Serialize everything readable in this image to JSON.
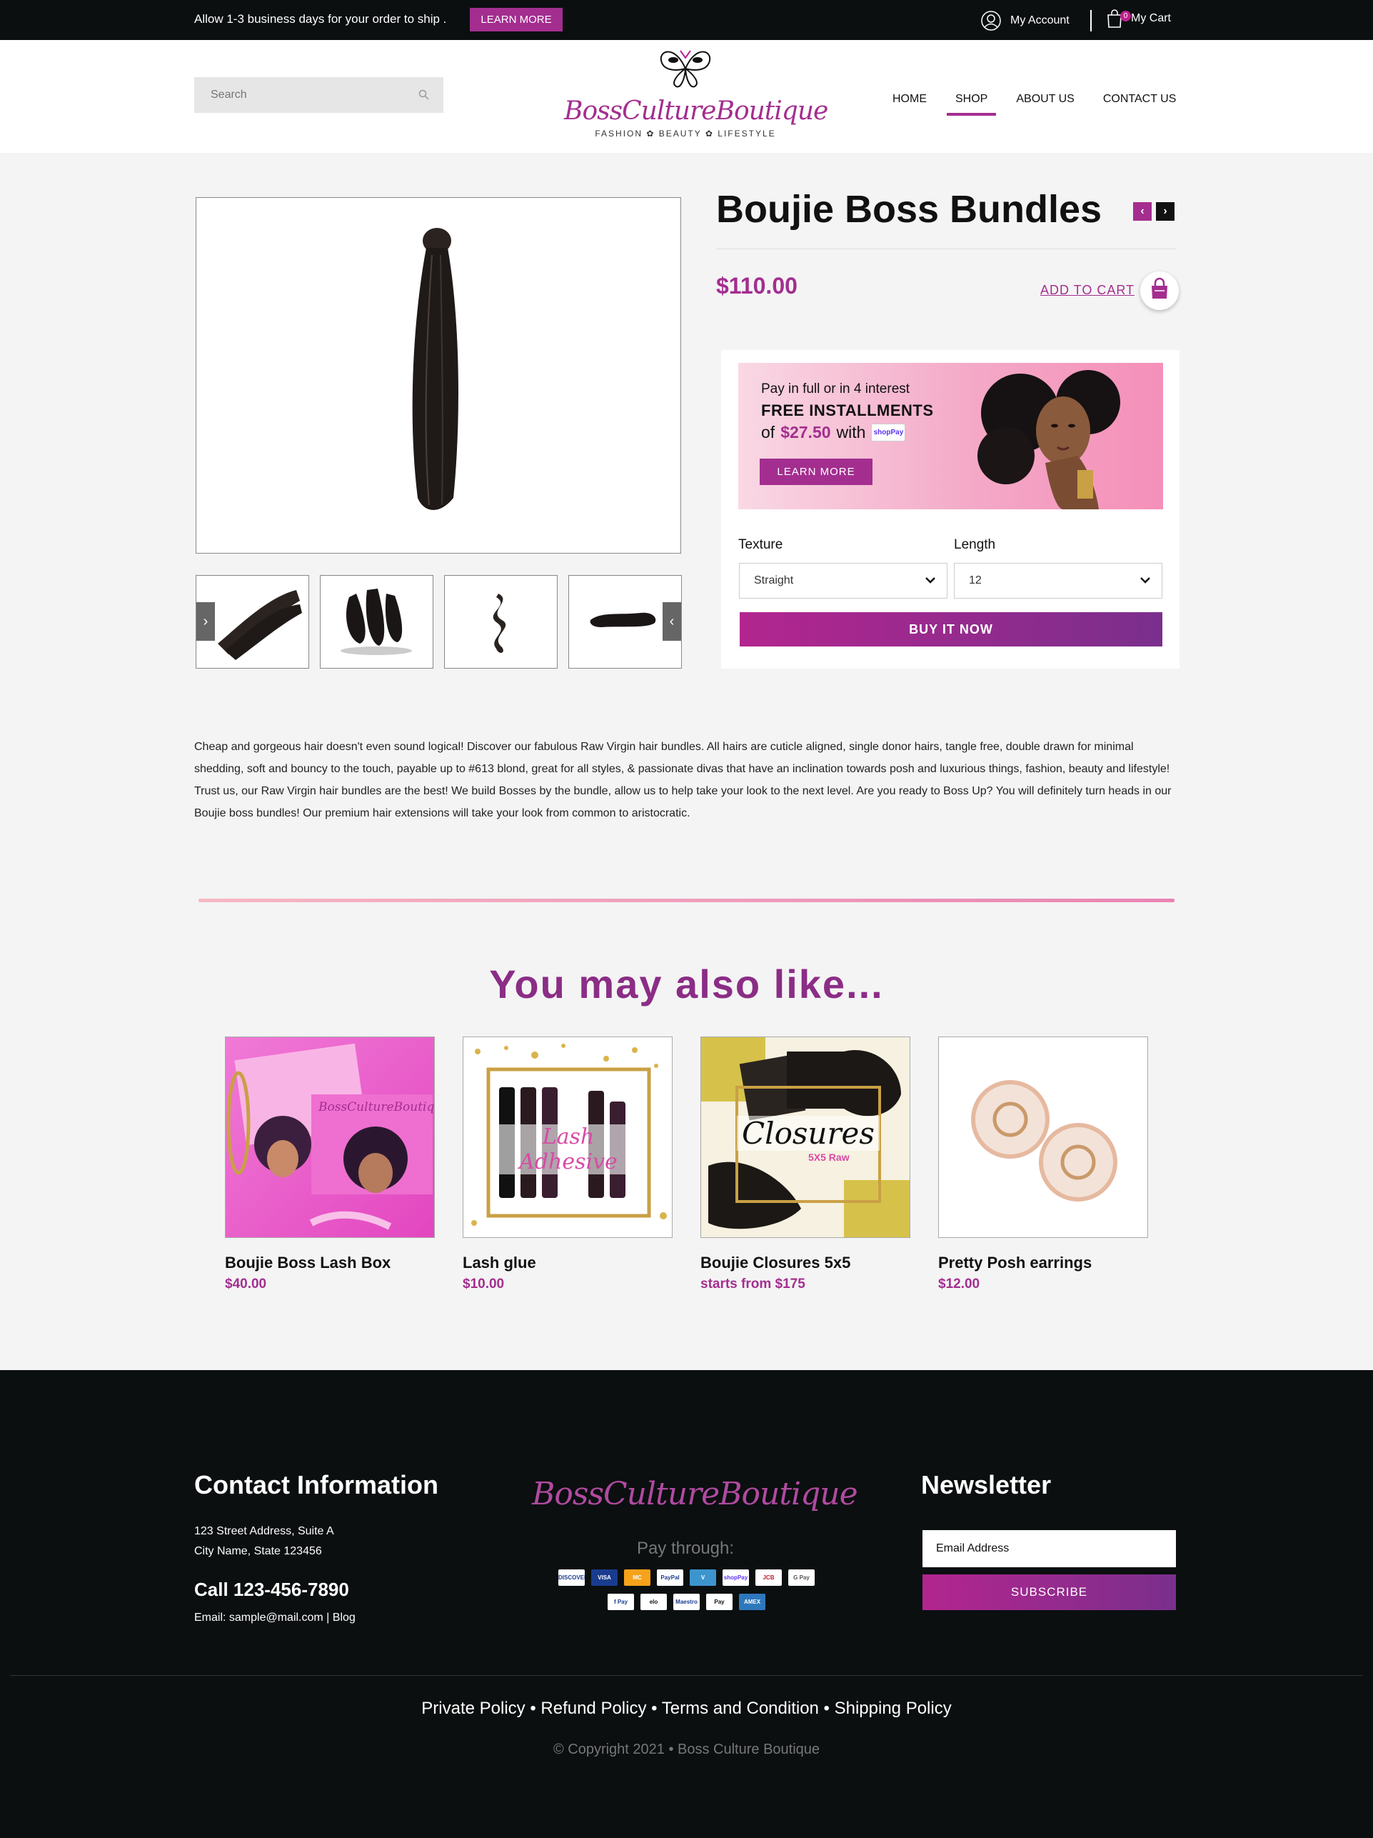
{
  "topbar": {
    "notice": "Allow 1-3 business days for your order to ship .",
    "learn_more": "LEARN MORE",
    "account": "My Account",
    "cart": "My Cart",
    "cart_count": "0"
  },
  "header": {
    "search_placeholder": "Search",
    "logo_text": "BossCultureBoutique",
    "logo_tagline": "FASHION ✿ BEAUTY ✿ LIFESTYLE",
    "nav": [
      "HOME",
      "SHOP",
      "ABOUT US",
      "CONTACT US"
    ],
    "active_nav": "SHOP"
  },
  "product": {
    "title": "Boujie Boss Bundles",
    "price": "$110.00",
    "add_to_cart": "ADD TO CART",
    "promo": {
      "line1": "Pay in full or in 4 interest",
      "line2": "FREE INSTALLMENTS",
      "line3_prefix": "of",
      "amount": "$27.50",
      "line3_suffix": "with",
      "shoppay": "shopPay",
      "learn_more": "LEARN MORE"
    },
    "texture_label": "Texture",
    "texture_value": "Straight",
    "length_label": "Length",
    "length_value": "12",
    "buy_now": "BUY IT NOW",
    "description": "Cheap and gorgeous hair doesn't even sound logical! Discover our fabulous Raw Virgin hair bundles. All hairs are cuticle aligned, single donor hairs, tangle free, double drawn for minimal shedding, soft and bouncy to the touch, payable up to #613 blond, great for all styles, & passionate divas that have an inclination towards posh and luxurious things, fashion, beauty and lifestyle! Trust us, our Raw Virgin hair bundles are the best! We build Bosses by the bundle, allow us to help take your look to the next level. Are you ready to Boss Up? You will definitely turn heads in our Boujie boss bundles! Our premium hair extensions will take your look from common to aristocratic."
  },
  "related": {
    "heading": "You may also like...",
    "items": [
      {
        "name": "Boujie Boss Lash Box",
        "price": "$40.00",
        "image_text": "BossCultureBoutique"
      },
      {
        "name": "Lash glue",
        "price": "$10.00",
        "image_text": "Lash Adhesive"
      },
      {
        "name": "Boujie Closures 5x5",
        "price": "starts from $175",
        "image_text": "Closures",
        "image_sub": "5X5 Raw"
      },
      {
        "name": "Pretty Posh earrings",
        "price": "$12.00"
      }
    ]
  },
  "footer": {
    "contact_heading": "Contact Information",
    "address_line1": "123 Street Address, Suite A",
    "address_line2": "City Name, State 123456",
    "call": "Call 123-456-7890",
    "email_line": "Email: sample@mail.com | Blog",
    "logo_text": "BossCultureBoutique",
    "pay_through": "Pay through:",
    "pay_row1": [
      "DISCOVER",
      "VISA",
      "MC",
      "PayPal",
      "V",
      "shopPay",
      "JCB",
      "G Pay"
    ],
    "pay_row2": [
      "f Pay",
      "elo",
      "Maestro",
      "Pay",
      "AMEX"
    ],
    "newsletter_heading": "Newsletter",
    "email_placeholder": "Email Address",
    "subscribe": "SUBSCRIBE",
    "links": "Private Policy • Refund Policy •  Terms and Condition • Shipping Policy",
    "copyright": "© Copyright 2021 •  Boss Culture Boutique"
  }
}
